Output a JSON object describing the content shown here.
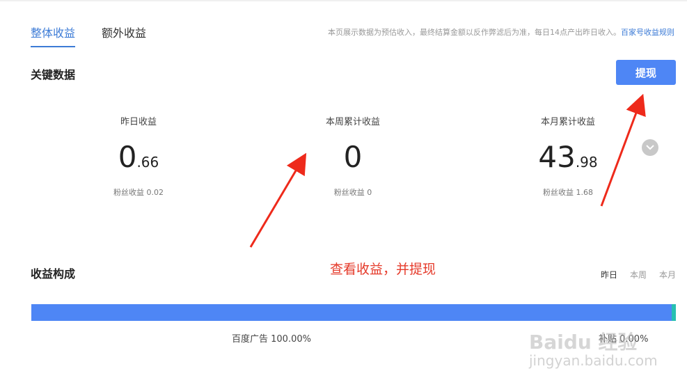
{
  "tabs": [
    {
      "label": "整体收益",
      "active": true
    },
    {
      "label": "额外收益",
      "active": false
    }
  ],
  "notice": {
    "text": "本页展示数据为预估收入，最终结算金额以反作弊滤后为准，每日14点产出昨日收入。",
    "link": "百家号收益规则"
  },
  "key_data": {
    "title": "关键数据",
    "withdraw_label": "提现",
    "stats": [
      {
        "label": "昨日收益",
        "value_int": "0",
        "value_dec": ".66",
        "sub": "粉丝收益 0.02"
      },
      {
        "label": "本周累计收益",
        "value_int": "0",
        "value_dec": "",
        "sub": "粉丝收益 0"
      },
      {
        "label": "本月累计收益",
        "value_int": "43",
        "value_dec": ".98",
        "sub": "粉丝收益 1.68"
      }
    ]
  },
  "composition": {
    "title": "收益构成",
    "periods": [
      "昨日",
      "本周",
      "本月"
    ],
    "active_period": "昨日",
    "items": [
      {
        "label": "百度广告 100.00%",
        "share": 1.0,
        "color": "#4e86f5"
      },
      {
        "label": "补贴 0.00%",
        "share": 0.0,
        "color": "#27c0b1"
      }
    ]
  },
  "annotation": "查看收益，并提现",
  "watermark": {
    "logo": "Baidu 经验",
    "url": "jingyan.baidu.com"
  },
  "colors": {
    "accent": "#3c7bd6",
    "button": "#4e86f5",
    "annotation": "#e53a2a"
  }
}
